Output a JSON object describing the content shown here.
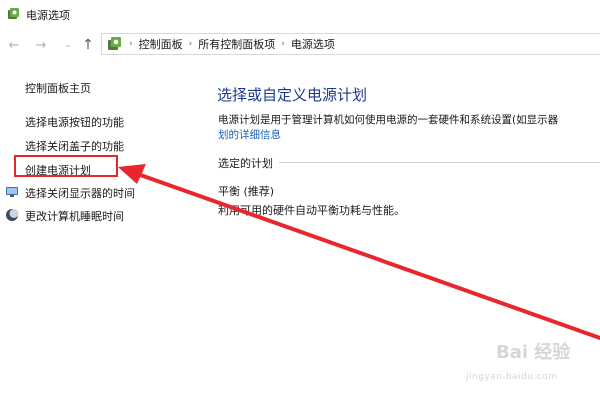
{
  "window": {
    "title": "电源选项",
    "icon": "power-options-icon"
  },
  "navigation": {
    "back_icon": "back-arrow-icon",
    "forward_icon": "forward-arrow-icon",
    "recent_icon": "chevron-down-icon",
    "up_icon": "up-arrow-icon"
  },
  "address_bar": {
    "icon": "power-options-icon",
    "breadcrumbs": [
      "控制面板",
      "所有控制面板项",
      "电源选项"
    ]
  },
  "sidebar": {
    "home_label": "控制面板主页",
    "items": [
      {
        "label": "选择电源按钮的功能",
        "icon": null
      },
      {
        "label": "选择关闭盖子的功能",
        "icon": null
      },
      {
        "label": "创建电源计划",
        "icon": null,
        "highlighted": true
      },
      {
        "label": "选择关闭显示器的时间",
        "icon": "monitor-icon"
      },
      {
        "label": "更改计算机睡眠时间",
        "icon": "moon-icon"
      }
    ]
  },
  "main": {
    "heading": "选择或自定义电源计划",
    "description_line1": "电源计划是用于管理计算机如何使用电源的一套硬件和系统设置(如显示器",
    "description_line2": "划的详细信息",
    "selected_plan_section": "选定的计划",
    "plan_name": "平衡 (推荐)",
    "plan_description": "利用可用的硬件自动平衡功耗与性能。"
  },
  "annotation": {
    "highlight_color": "#e8262b",
    "arrow_color": "#e8262b"
  },
  "watermark": {
    "text": "Bai 经验",
    "url": "jingyan.baidu.com"
  },
  "colors": {
    "heading": "#1e3a8a",
    "link": "#1a5fb4",
    "background": "#ffffff"
  }
}
